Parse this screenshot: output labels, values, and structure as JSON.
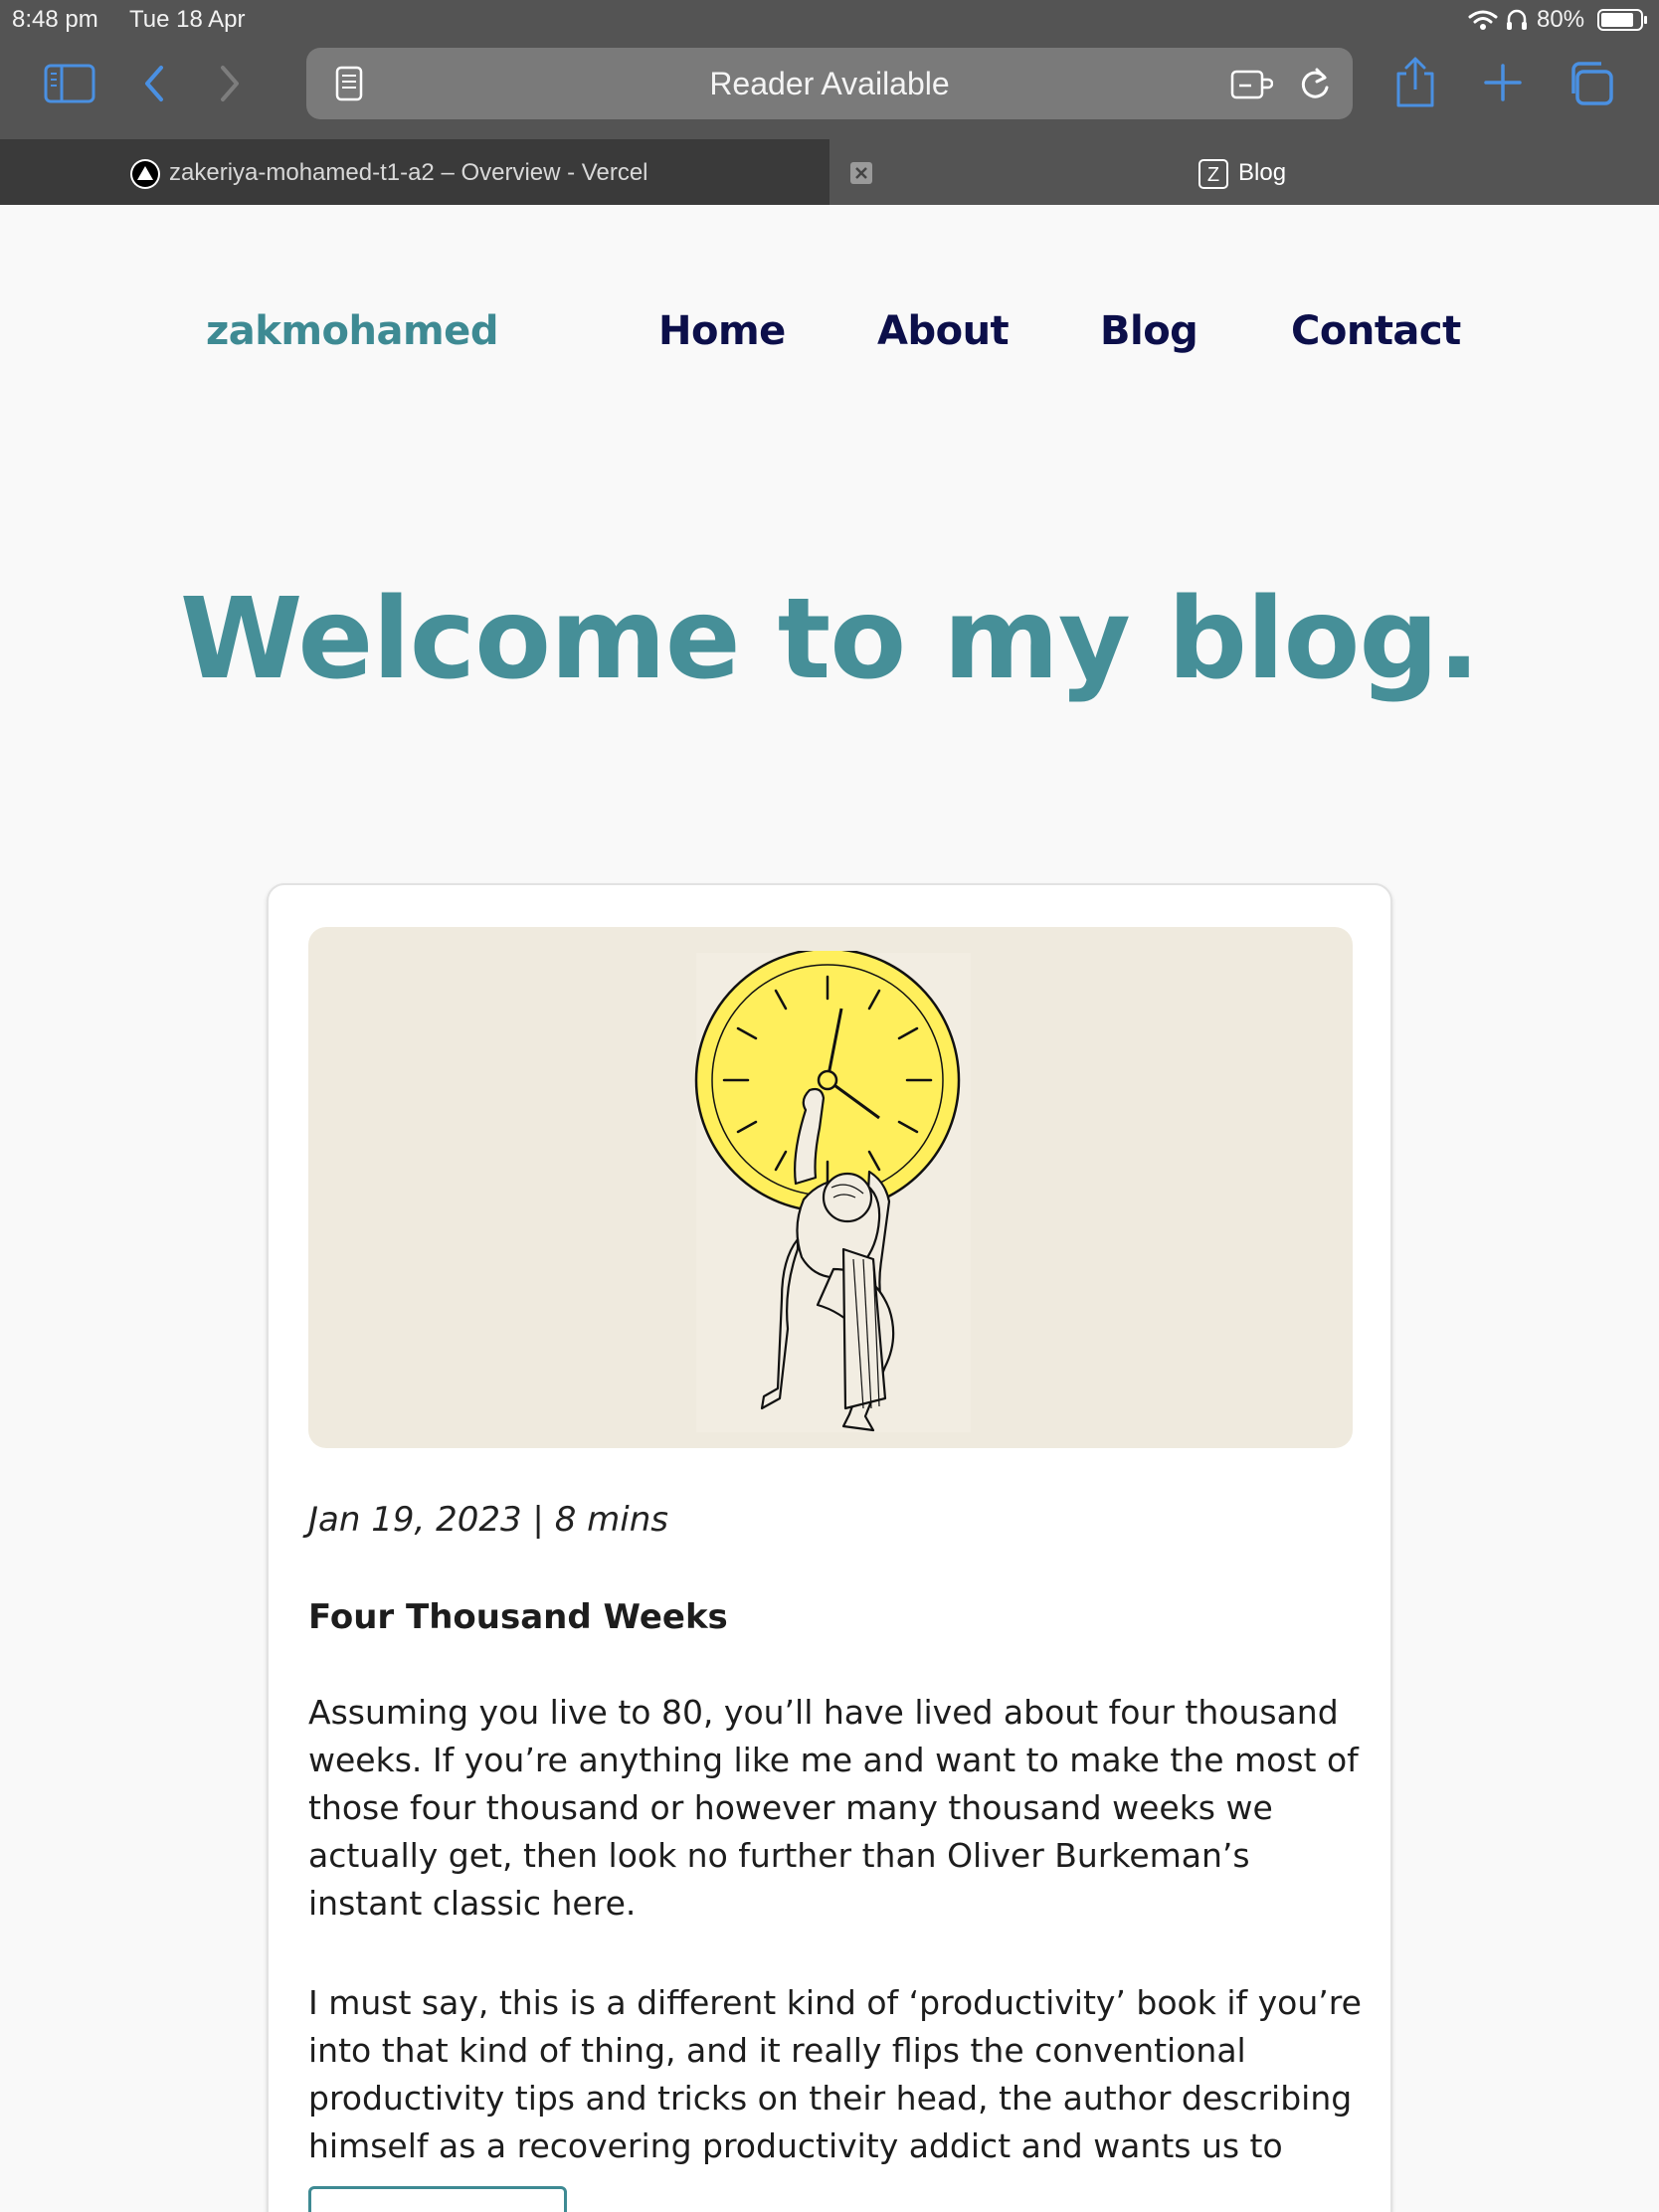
{
  "status_bar": {
    "time": "8:48 pm",
    "date": "Tue 18 Apr",
    "battery": "80%"
  },
  "browser": {
    "address_text": "Reader Available",
    "tabs": [
      {
        "label": "zakeriya-mohamed-t1-a2 – Overview - Vercel",
        "favicon": "vercel-icon"
      },
      {
        "label": "Blog",
        "favicon": "z-icon",
        "favicon_letter": "Z"
      }
    ],
    "accent_color": "#4a90e2"
  },
  "site": {
    "logo": "zakmohamed",
    "nav": {
      "home": "Home",
      "about": "About",
      "blog": "Blog",
      "contact": "Contact"
    },
    "hero_title": "Welcome to my blog.",
    "brand_color": "#3e8a93",
    "nav_color": "#0c0f4a"
  },
  "post": {
    "meta": "Jan 19, 2023 | 8 mins",
    "title": "Four Thousand Weeks",
    "paragraph_1": "Assuming you live to 80, you’ll have lived about four thousand weeks. If you’re anything like me and want to make the most of those four thousand or however many thousand weeks we actually get, then look no further than Oliver Burkeman’s instant classic here.",
    "paragraph_2": "I must say, this is a different kind of ‘productivity’ book if you’re into that kind of thing, and it really flips the conventional productivity tips and tricks on their head, the author describing himself as a recovering productivity addict and wants us to",
    "image_icon": "atlas-holding-clock-illustration"
  }
}
